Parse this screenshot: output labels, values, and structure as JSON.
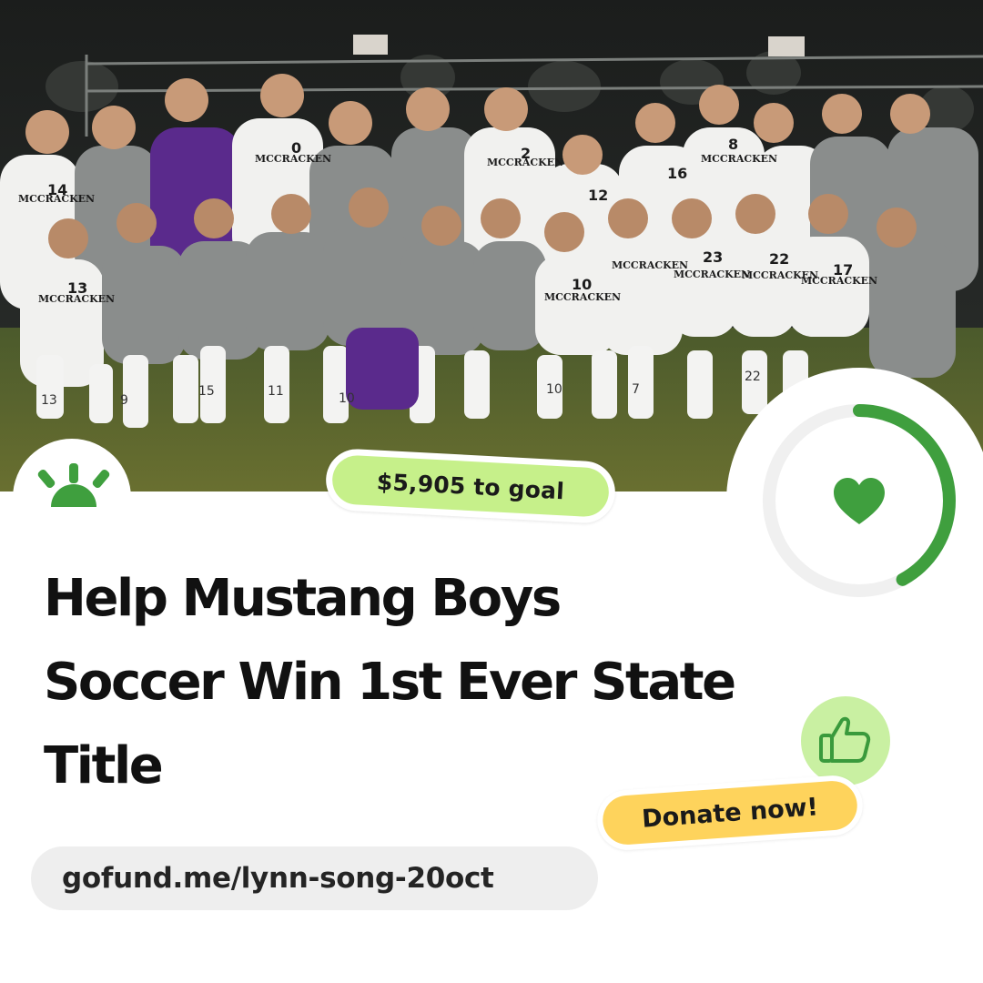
{
  "campaign": {
    "photo_alt": "McCracken team photo",
    "goal_badge": "$5,905 to goal",
    "title": "Help Mustang Boys Soccer Win 1st Ever State Title",
    "cta": "Donate now!",
    "url": "gofund.me/lynn-song-20oct"
  },
  "team": {
    "jersey_text": "MCCRACKEN",
    "numbers_back_row": [
      "14",
      "0",
      "2",
      "12",
      "16",
      "8"
    ],
    "numbers_front_row": [
      "13",
      "10",
      "23",
      "22",
      "17"
    ],
    "sock_numbers": [
      "13",
      "9",
      "15",
      "11",
      "10",
      "10",
      "7",
      "22"
    ]
  },
  "progress": {
    "fraction": 0.42
  },
  "colors": {
    "brand_green": "#3f9f3e",
    "goal_badge_bg": "#c6f08a",
    "donate_bg": "#fed35c",
    "thumb_bg": "#c9f0a2",
    "url_bg": "#eeeeee",
    "track": "#f0f0f0"
  },
  "icons": {
    "logo": "gofundme-logo-icon",
    "heart": "heart-icon",
    "thumb": "thumbs-up-icon"
  }
}
